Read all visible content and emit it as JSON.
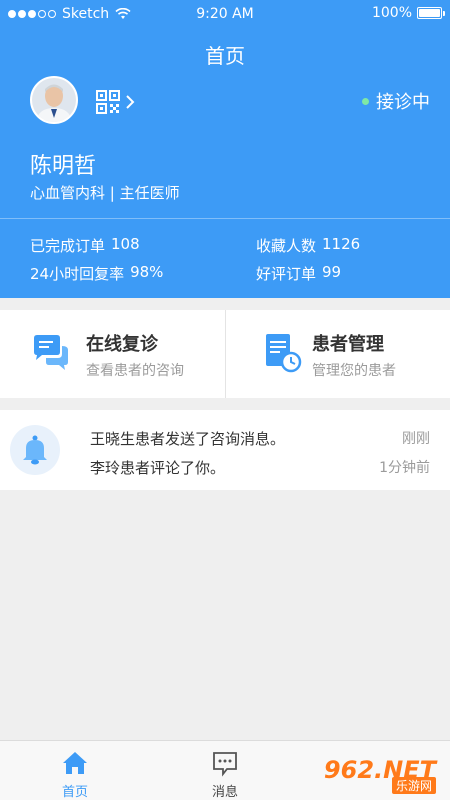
{
  "status_bar": {
    "carrier": "Sketch",
    "time": "9:20 AM",
    "battery": "100%"
  },
  "header": {
    "title": "首页",
    "status_label": "接诊中",
    "doctor": {
      "name": "陈明哲",
      "title": "心血管内科 | 主任医师"
    },
    "stats": [
      {
        "label": "已完成订单",
        "value": "108"
      },
      {
        "label": "收藏人数",
        "value": "1126"
      },
      {
        "label": "24小时回复率",
        "value": "98%"
      },
      {
        "label": "好评订单",
        "value": "99"
      }
    ],
    "colors": {
      "primary": "#3d9bf6",
      "online_dot": "#7fe8a5"
    }
  },
  "quick_actions": [
    {
      "title": "在线复诊",
      "subtitle": "查看患者的咨询",
      "icon": "chat-bubbles-icon"
    },
    {
      "title": "患者管理",
      "subtitle": "管理您的患者",
      "icon": "document-clock-icon"
    }
  ],
  "notices": [
    {
      "text": "王晓生患者发送了咨询消息。",
      "time": "刚刚"
    },
    {
      "text": "李玲患者评论了你。",
      "time": "1分钟前"
    }
  ],
  "tabs": [
    {
      "label": "首页",
      "icon": "home-icon",
      "active": true
    },
    {
      "label": "消息",
      "icon": "message-icon",
      "active": false
    },
    {
      "label": "",
      "icon": "profile-icon",
      "active": false
    }
  ],
  "watermark": {
    "text": "962.NET",
    "sub": "乐游网"
  }
}
